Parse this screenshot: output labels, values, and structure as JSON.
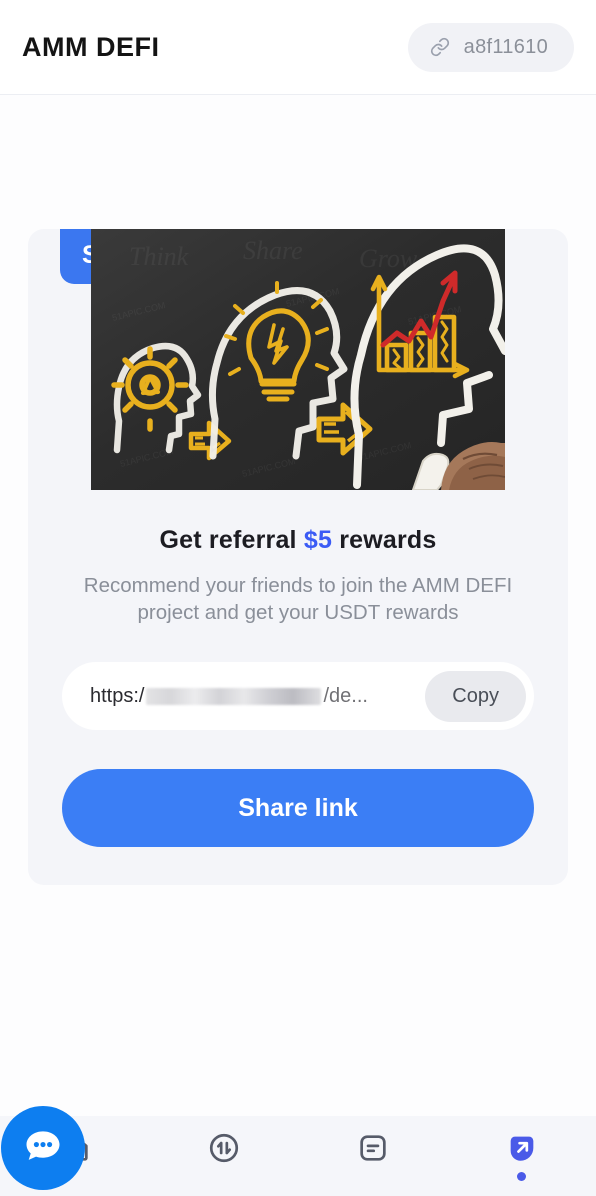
{
  "header": {
    "brand": "AMM DEFI",
    "wallet_icon": "link-icon",
    "wallet_address": "a8f11610"
  },
  "card": {
    "badge": "SHARE",
    "hero_image_alt": "chalkboard-idea-sharing-illustration",
    "headline_prefix": "Get referral ",
    "headline_amount": "$5",
    "headline_suffix": " rewards",
    "description": "Recommend your friends to join the AMM DEFI project and get your USDT rewards",
    "link_prefix": "https:/",
    "link_suffix": "/de...",
    "copy_label": "Copy",
    "share_label": "Share link"
  },
  "nav": {
    "items": [
      {
        "name": "home",
        "icon": "home-icon",
        "active": false
      },
      {
        "name": "swap",
        "icon": "swap-icon",
        "active": false
      },
      {
        "name": "orders",
        "icon": "document-icon",
        "active": false
      },
      {
        "name": "share",
        "icon": "share-arrow-icon",
        "active": true
      }
    ],
    "fab_icon": "chat-bubble-icon"
  },
  "colors": {
    "accent_blue": "#3b7ef5",
    "amount_blue": "#3b5bf5",
    "active_nav": "#4a5ae8",
    "fab_blue": "#0d7ef0",
    "card_bg": "#f4f5f9",
    "nav_bg": "#f5f6fa",
    "chalk_white": "#f2f0ea",
    "chalk_yellow": "#e8b01e",
    "chalk_red": "#cf2a2a"
  }
}
